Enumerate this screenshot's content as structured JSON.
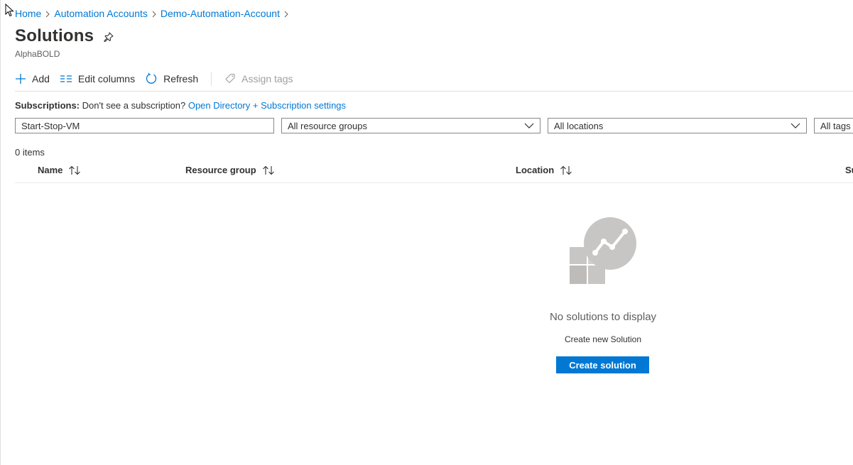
{
  "breadcrumb": {
    "items": [
      "Home",
      "Automation Accounts",
      "Demo-Automation-Account"
    ]
  },
  "page": {
    "title": "Solutions",
    "subtitle": "AlphaBOLD"
  },
  "toolbar": {
    "add_label": "Add",
    "edit_columns_label": "Edit columns",
    "refresh_label": "Refresh",
    "assign_tags_label": "Assign tags"
  },
  "subscriptions": {
    "label": "Subscriptions:",
    "text": "Don't see a subscription?",
    "link": "Open Directory + Subscription settings"
  },
  "filters": {
    "search_value": "Start-Stop-VM",
    "resource_groups": "All resource groups",
    "locations": "All locations",
    "tags": "All tags"
  },
  "list": {
    "count": "0 items",
    "columns": [
      "Name",
      "Resource group",
      "Location",
      "Su"
    ]
  },
  "empty_state": {
    "message": "No solutions to display",
    "sub_message": "Create new Solution",
    "button_label": "Create solution"
  },
  "icons": {
    "add": "plus-icon",
    "edit_columns": "columns-icon",
    "refresh": "refresh-icon",
    "assign_tags": "tag-icon",
    "pin": "pin-icon",
    "sort": "sort-arrows-icon",
    "dropdown": "chevron-down-icon",
    "empty": "solutions-chart-icon"
  },
  "colors": {
    "accent": "#0078d4",
    "text": "#323130",
    "muted": "#605e5c",
    "border": "#8a8886",
    "illustration": "#c8c6c4"
  }
}
